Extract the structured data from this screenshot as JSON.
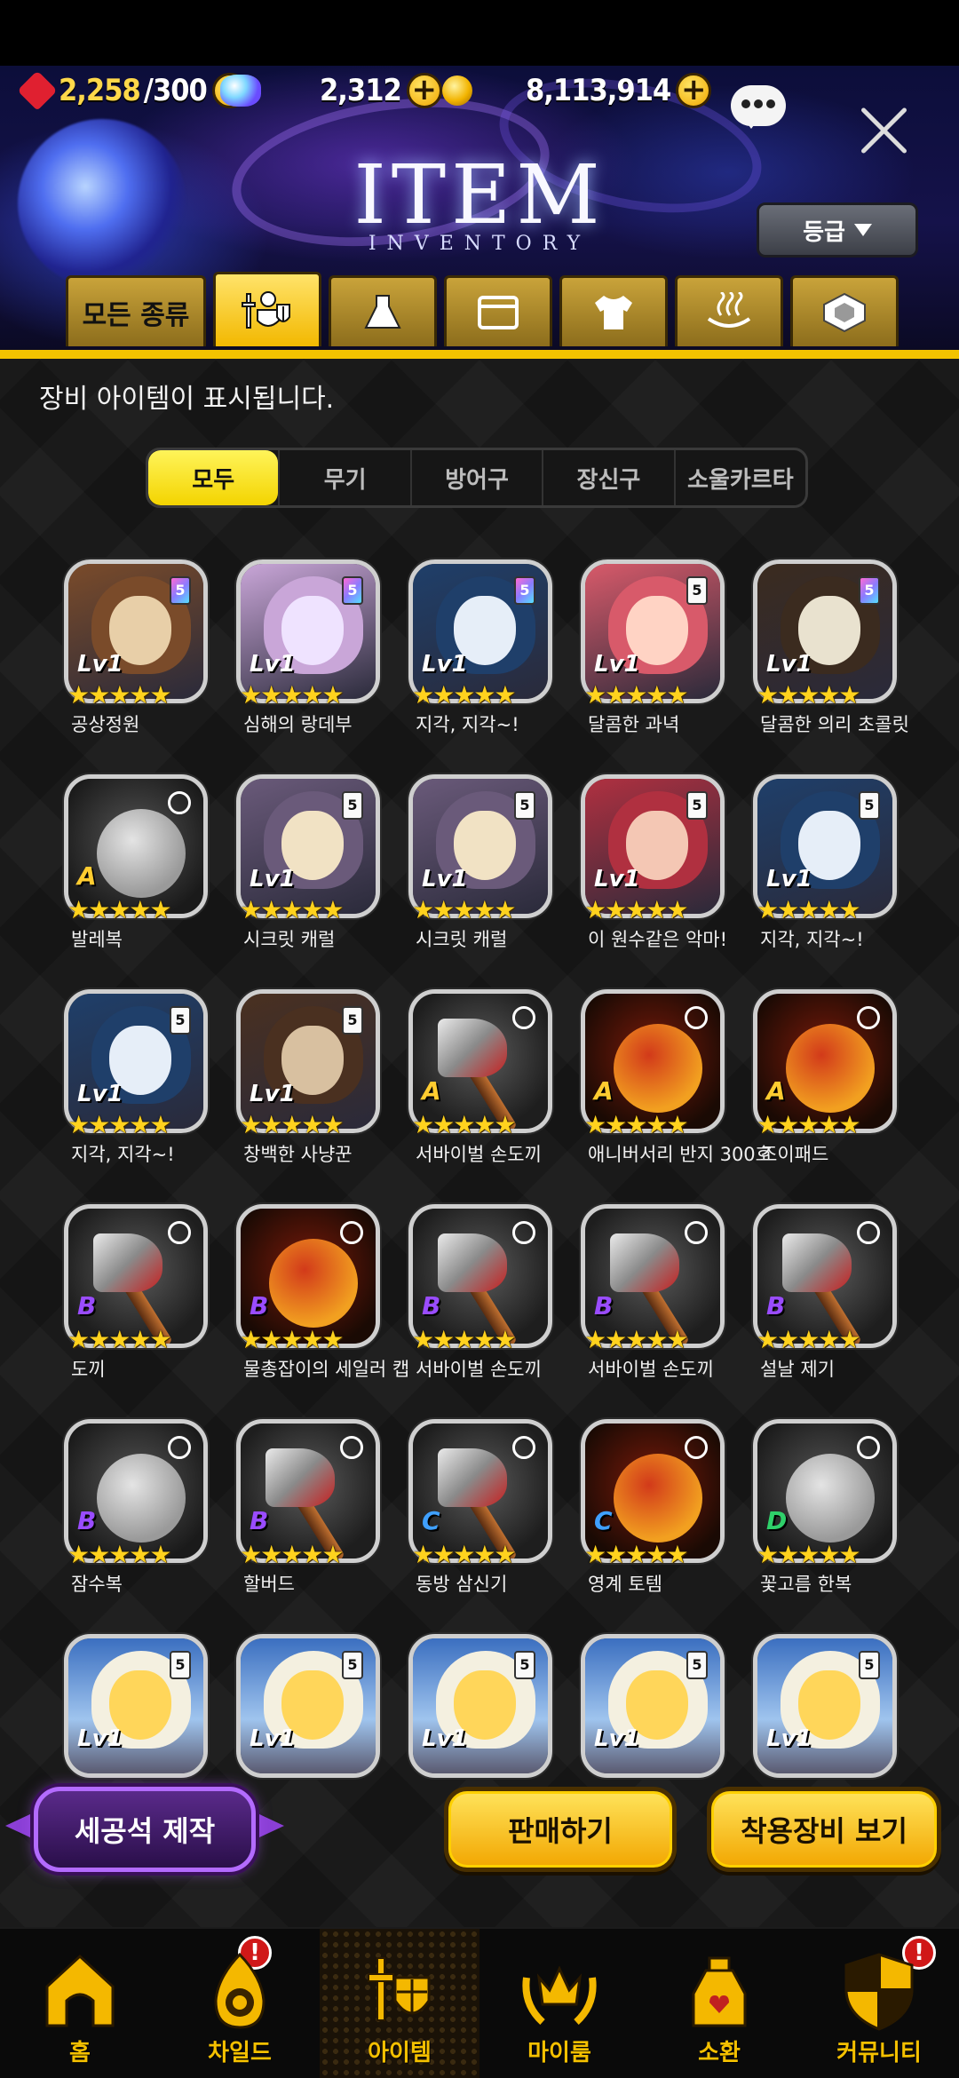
{
  "resources": {
    "stamina": "2,258",
    "stamina_max": "/300",
    "gems": "2,312",
    "gold": "8,113,914"
  },
  "header": {
    "title": "ITEM",
    "subtitle": "INVENTORY",
    "grade_button": "등급"
  },
  "category_tabs": [
    {
      "label": "모든 종류",
      "icon": "all-types",
      "active": false
    },
    {
      "label": "",
      "icon": "knight-equipment-icon",
      "active": true
    },
    {
      "label": "",
      "icon": "flask-icon",
      "active": false
    },
    {
      "label": "",
      "icon": "card-icon",
      "active": false
    },
    {
      "label": "",
      "icon": "shirt-icon",
      "active": false
    },
    {
      "label": "",
      "icon": "hot-spring-icon",
      "active": false
    },
    {
      "label": "",
      "icon": "emblem-icon",
      "active": false
    }
  ],
  "description": "장비 아이템이 표시됩니다.",
  "sub_tabs": [
    "모두",
    "무기",
    "방어구",
    "장신구",
    "소울카르타"
  ],
  "sub_tab_active": 0,
  "items": [
    {
      "name": "공상정원",
      "type": "card",
      "level": "Lv1",
      "badge": "5",
      "stars": 5
    },
    {
      "name": "심해의 랑데부",
      "type": "card",
      "level": "Lv1",
      "badge": "5",
      "stars": 5
    },
    {
      "name": "지각, 지각~!",
      "type": "card",
      "level": "Lv1",
      "badge": "5",
      "stars": 5
    },
    {
      "name": "달콤한 과녁",
      "type": "card",
      "level": "Lv1",
      "badge": "5",
      "stars": 5
    },
    {
      "name": "달콤한 의리 초콜릿",
      "type": "card",
      "level": "Lv1",
      "badge": "5",
      "stars": 5
    },
    {
      "name": "발레복",
      "type": "armor",
      "grade": "A",
      "stars": 5
    },
    {
      "name": "시크릿 캐럴",
      "type": "card",
      "level": "Lv1",
      "badge": "5",
      "stars": 5
    },
    {
      "name": "시크릿 캐럴",
      "type": "card",
      "level": "Lv1",
      "badge": "5",
      "stars": 5
    },
    {
      "name": "이 원수같은 악마!",
      "type": "card",
      "level": "Lv1",
      "badge": "5",
      "stars": 5
    },
    {
      "name": "지각, 지각~!",
      "type": "card",
      "level": "Lv1",
      "badge": "5",
      "stars": 5
    },
    {
      "name": "지각, 지각~!",
      "type": "card",
      "level": "Lv1",
      "badge": "5",
      "stars": 5
    },
    {
      "name": "창백한 사냥꾼",
      "type": "card",
      "level": "Lv1",
      "badge": "5",
      "stars": 5
    },
    {
      "name": "서바이벌 손도끼",
      "type": "weapon",
      "grade": "A",
      "stars": 5
    },
    {
      "name": "애니버서리 반지 300호",
      "type": "accessory",
      "grade": "A",
      "stars": 5
    },
    {
      "name": "조이패드",
      "type": "accessory",
      "grade": "A",
      "stars": 5
    },
    {
      "name": "도끼",
      "type": "weapon",
      "grade": "B",
      "stars": 5
    },
    {
      "name": "물총잡이의 세일러 캡",
      "type": "accessory",
      "grade": "B",
      "stars": 5
    },
    {
      "name": "서바이벌 손도끼",
      "type": "weapon",
      "grade": "B",
      "stars": 5
    },
    {
      "name": "서바이벌 손도끼",
      "type": "weapon",
      "grade": "B",
      "stars": 5
    },
    {
      "name": "설날 제기",
      "type": "weapon",
      "grade": "B",
      "stars": 5
    },
    {
      "name": "잠수복",
      "type": "armor",
      "grade": "B",
      "stars": 5
    },
    {
      "name": "할버드",
      "type": "weapon",
      "grade": "B",
      "stars": 5
    },
    {
      "name": "동방 삼신기",
      "type": "weapon",
      "grade": "C",
      "stars": 5
    },
    {
      "name": "영계 토템",
      "type": "accessory",
      "grade": "C",
      "stars": 5
    },
    {
      "name": "꽃고름 한복",
      "type": "armor",
      "grade": "D",
      "stars": 5
    },
    {
      "name": "",
      "type": "card",
      "level": "Lv1",
      "badge": "5",
      "stars": 0
    },
    {
      "name": "",
      "type": "card",
      "level": "Lv1",
      "badge": "5",
      "stars": 0
    },
    {
      "name": "",
      "type": "card",
      "level": "Lv1",
      "badge": "5",
      "stars": 0
    },
    {
      "name": "",
      "type": "card",
      "level": "Lv1",
      "badge": "5",
      "stars": 0
    },
    {
      "name": "",
      "type": "card",
      "level": "Lv1",
      "badge": "5",
      "stars": 0
    }
  ],
  "actions": {
    "craft": "세공석 제작",
    "sell": "판매하기",
    "equip": "착용장비 보기"
  },
  "nav": [
    {
      "label": "홈",
      "icon": "home-icon",
      "alert": false,
      "active": false
    },
    {
      "label": "차일드",
      "icon": "child-flame-icon",
      "alert": true,
      "active": false
    },
    {
      "label": "아이템",
      "icon": "item-sword-icon",
      "alert": false,
      "active": true
    },
    {
      "label": "마이룸",
      "icon": "crown-icon",
      "alert": false,
      "active": false
    },
    {
      "label": "소환",
      "icon": "potion-icon",
      "alert": false,
      "active": false
    },
    {
      "label": "커뮤니티",
      "icon": "shield-icon",
      "alert": true,
      "active": false
    }
  ],
  "alert_mark": "!",
  "colors": {
    "accent_yellow": "#f3c300",
    "craft_purple": "#b36bff",
    "star": "#ffd21e",
    "alert_red": "#d01818"
  }
}
